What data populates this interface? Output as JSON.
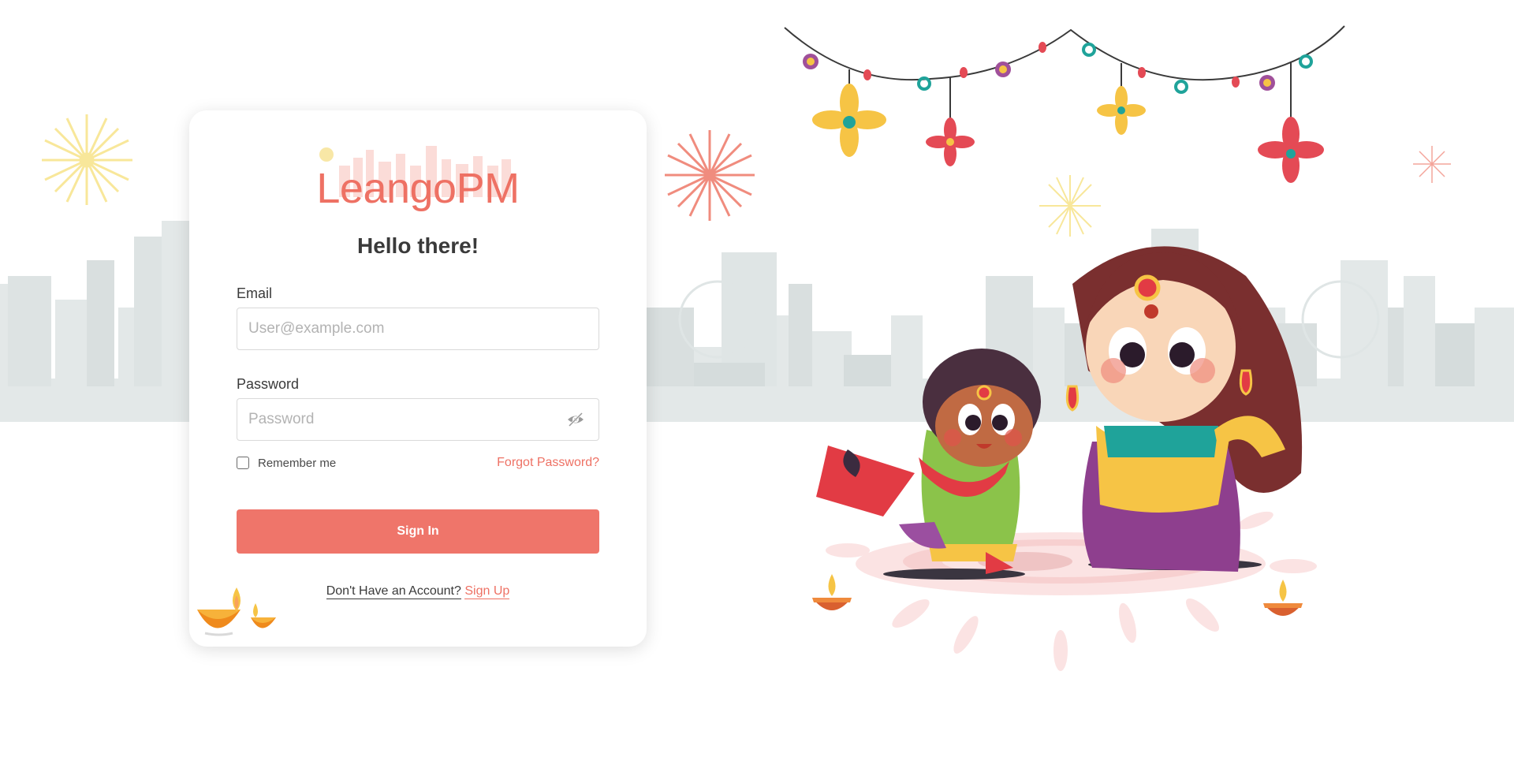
{
  "brand": {
    "name": "LeangoPM",
    "color": "#ee7164"
  },
  "login": {
    "greeting": "Hello there!",
    "email_label": "Email",
    "email_placeholder": "User@example.com",
    "password_label": "Password",
    "password_placeholder": "Password",
    "password_toggle_icon": "eye-slash-icon",
    "remember_label": "Remember me",
    "forgot_label": "Forgot Password?",
    "signin_label": "Sign In",
    "signup_prompt": "Don't Have an Account?",
    "signup_link": "Sign Up"
  },
  "theme": {
    "accent": "#ef756a",
    "skyline": "#e3e8e8",
    "text": "#3a3a3a"
  },
  "illustration": {
    "subject": "diwali-celebration",
    "icons": [
      "garland-icon",
      "firework-icon",
      "diya-lamp-icon",
      "city-skyline-icon",
      "girl-illustration-icon",
      "woman-illustration-icon"
    ]
  }
}
